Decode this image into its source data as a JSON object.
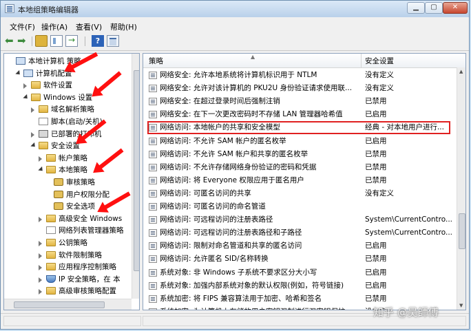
{
  "window": {
    "title": "本地组策略编辑器"
  },
  "menu": [
    "文件(F)",
    "操作(A)",
    "查看(V)",
    "帮助(H)"
  ],
  "tree": [
    {
      "label": "本地计算机 策略",
      "indent": 0,
      "icon": "computer-policy-icon",
      "arrow": "none"
    },
    {
      "label": "计算机配置",
      "indent": 1,
      "icon": "computer-icon",
      "arrow": "open"
    },
    {
      "label": "软件设置",
      "indent": 2,
      "icon": "folder-icon",
      "arrow": "closed"
    },
    {
      "label": "Windows 设置",
      "indent": 2,
      "icon": "folder-icon",
      "arrow": "open"
    },
    {
      "label": "域名解析策略",
      "indent": 3,
      "icon": "folder-icon",
      "arrow": "closed"
    },
    {
      "label": "脚本(启动/关机)",
      "indent": 3,
      "icon": "script-icon",
      "arrow": "none"
    },
    {
      "label": "已部署的打印机",
      "indent": 3,
      "icon": "printer-icon",
      "arrow": "closed"
    },
    {
      "label": "安全设置",
      "indent": 3,
      "icon": "security-icon",
      "arrow": "open"
    },
    {
      "label": "帐户策略",
      "indent": 4,
      "icon": "folder-icon",
      "arrow": "closed"
    },
    {
      "label": "本地策略",
      "indent": 4,
      "icon": "folder-icon",
      "arrow": "open"
    },
    {
      "label": "审核策略",
      "indent": 5,
      "icon": "lock-folder-icon",
      "arrow": "none"
    },
    {
      "label": "用户权限分配",
      "indent": 5,
      "icon": "lock-folder-icon",
      "arrow": "none"
    },
    {
      "label": "安全选项",
      "indent": 5,
      "icon": "lock-folder-icon",
      "arrow": "none"
    },
    {
      "label": "高级安全 Windows",
      "indent": 4,
      "icon": "folder-icon",
      "arrow": "closed"
    },
    {
      "label": "网络列表管理器策略",
      "indent": 4,
      "icon": "doc-icon",
      "arrow": "none"
    },
    {
      "label": "公钥策略",
      "indent": 4,
      "icon": "folder-icon",
      "arrow": "closed"
    },
    {
      "label": "软件限制策略",
      "indent": 4,
      "icon": "folder-icon",
      "arrow": "closed"
    },
    {
      "label": "应用程序控制策略",
      "indent": 4,
      "icon": "folder-icon",
      "arrow": "closed"
    },
    {
      "label": "IP 安全策略，在 本",
      "indent": 4,
      "icon": "shield-icon",
      "arrow": "closed"
    },
    {
      "label": "高级审核策略配置",
      "indent": 4,
      "icon": "folder-icon",
      "arrow": "closed"
    }
  ],
  "list": {
    "headers": {
      "policy": "策略",
      "setting": "安全设置"
    },
    "rows": [
      {
        "policy": "网络安全: 允许本地系统将计算机标识用于 NTLM",
        "setting": "没有定义"
      },
      {
        "policy": "网络安全: 允许对该计算机的 PKU2U 身份验证请求使用联...",
        "setting": "没有定义"
      },
      {
        "policy": "网络安全: 在超过登录时间后强制注销",
        "setting": "已禁用"
      },
      {
        "policy": "网络安全: 在下一次更改密码时不存储 LAN 管理器哈希值",
        "setting": "已启用"
      },
      {
        "policy": "网络访问: 本地帐户的共享和安全模型",
        "setting": "经典 - 对本地用户进行..."
      },
      {
        "policy": "网络访问: 不允许 SAM 帐户的匿名枚举",
        "setting": "已启用"
      },
      {
        "policy": "网络访问: 不允许 SAM 帐户和共享的匿名枚举",
        "setting": "已禁用"
      },
      {
        "policy": "网络访问: 不允许存储网络身份验证的密码和凭据",
        "setting": "已禁用"
      },
      {
        "policy": "网络访问: 将 Everyone 权限应用于匿名用户",
        "setting": "已禁用"
      },
      {
        "policy": "网络访问: 可匿名访问的共享",
        "setting": "没有定义"
      },
      {
        "policy": "网络访问: 可匿名访问的命名管道",
        "setting": ""
      },
      {
        "policy": "网络访问: 可远程访问的注册表路径",
        "setting": "System\\CurrentContro..."
      },
      {
        "policy": "网络访问: 可远程访问的注册表路径和子路径",
        "setting": "System\\CurrentContro..."
      },
      {
        "policy": "网络访问: 限制对命名管道和共享的匿名访问",
        "setting": "已启用"
      },
      {
        "policy": "网络访问: 允许匿名 SID/名称转换",
        "setting": "已禁用"
      },
      {
        "policy": "系统对象: 非 Windows 子系统不要求区分大小写",
        "setting": "已启用"
      },
      {
        "policy": "系统对象: 加强内部系统对象的默认权限(例如，符号链接)",
        "setting": "已启用"
      },
      {
        "policy": "系统加密: 将 FIPS 兼容算法用于加密、哈希和签名",
        "setting": "已禁用"
      },
      {
        "policy": "系统加密: 为计算机上存储的用户密钥强制进行强密钥保护",
        "setting": "没有定..."
      }
    ]
  },
  "watermark": "知乎 @吴師傅"
}
